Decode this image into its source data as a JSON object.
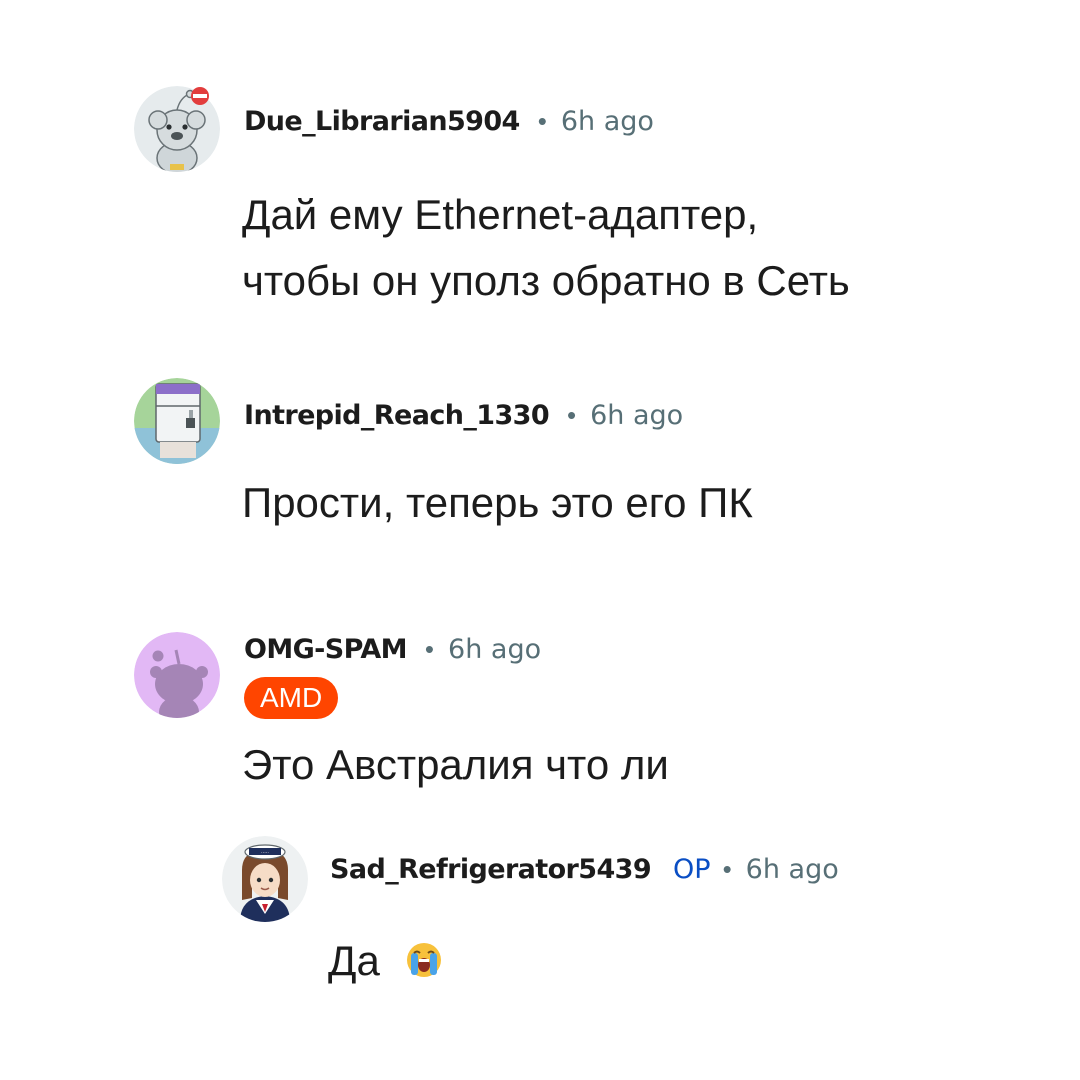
{
  "comments": [
    {
      "username": "Due_Librarian5904",
      "separator": "•",
      "time": "6h ago",
      "avatar_icon": "snoo-koala-avatar-icon",
      "lines": [
        "Дай ему Ethernet-адаптер,",
        "чтобы он уполз обратно в Сеть"
      ]
    },
    {
      "username": "Intrepid_Reach_1330",
      "separator": "•",
      "time": "6h ago",
      "avatar_icon": "refrigerator-avatar-icon",
      "lines": [
        "Прости, теперь это его ПК"
      ]
    },
    {
      "username": "OMG-SPAM",
      "separator": "•",
      "time": "6h ago",
      "flair": "AMD",
      "avatar_icon": "default-snoo-avatar-icon",
      "lines": [
        "Это Австралия что ли"
      ]
    },
    {
      "username": "Sad_Refrigerator5439",
      "op_label": "OP",
      "separator": "•",
      "time": "6h ago",
      "avatar_icon": "sailor-girl-avatar-icon",
      "lines": [
        "Да"
      ],
      "emoji": "crying-face-emoji-icon"
    }
  ],
  "colors": {
    "text": "#1c1c1c",
    "meta": "#576f76",
    "op": "#0a4ec4",
    "flair_bg": "#ff4500",
    "snoo_purple": "#e2b8f5"
  }
}
